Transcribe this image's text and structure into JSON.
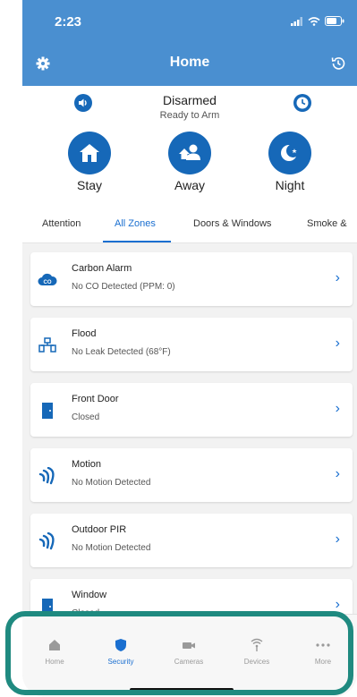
{
  "status_bar": {
    "time": "2:23"
  },
  "header": {
    "title": "Home"
  },
  "arm_panel": {
    "state": "Disarmed",
    "substate": "Ready to Arm",
    "modes": [
      {
        "label": "Stay",
        "icon": "house-icon"
      },
      {
        "label": "Away",
        "icon": "people-icon"
      },
      {
        "label": "Night",
        "icon": "moon-icon"
      }
    ]
  },
  "tabs": [
    {
      "label": "Attention",
      "active": false
    },
    {
      "label": "All Zones",
      "active": true
    },
    {
      "label": "Doors & Windows",
      "active": false
    },
    {
      "label": "Smoke &",
      "active": false
    }
  ],
  "zones": [
    {
      "name": "Carbon Alarm",
      "status": "No CO Detected (PPM: 0)",
      "icon": "co-icon"
    },
    {
      "name": "Flood",
      "status": "No Leak Detected (68°F)",
      "icon": "flood-icon"
    },
    {
      "name": "Front Door",
      "status": "Closed",
      "icon": "door-icon"
    },
    {
      "name": "Motion",
      "status": "No Motion Detected",
      "icon": "motion-icon"
    },
    {
      "name": "Outdoor PIR",
      "status": "No Motion Detected",
      "icon": "motion-icon"
    },
    {
      "name": "Window",
      "status": "Closed",
      "icon": "window-icon"
    }
  ],
  "bottom_nav": [
    {
      "label": "Home",
      "icon": "home-icon",
      "active": false
    },
    {
      "label": "Security",
      "icon": "shield-icon",
      "active": true
    },
    {
      "label": "Cameras",
      "icon": "camera-icon",
      "active": false
    },
    {
      "label": "Devices",
      "icon": "wifi-icon",
      "active": false
    },
    {
      "label": "More",
      "icon": "more-icon",
      "active": false
    }
  ],
  "colors": {
    "header_blue": "#4a8fd0",
    "accent_blue": "#1a6fd0",
    "mode_blue": "#1668b8",
    "highlight_teal": "#1f8a80"
  }
}
